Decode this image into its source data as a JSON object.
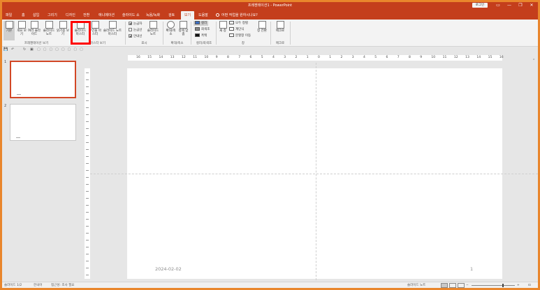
{
  "titlebar": {
    "title": "프레젠테이션1 - PowerPoint",
    "signin": "로그인",
    "minimize": "—",
    "restore": "❐",
    "close": "✕"
  },
  "tabs": [
    {
      "label": "파일"
    },
    {
      "label": "홈"
    },
    {
      "label": "삽입"
    },
    {
      "label": "그리기"
    },
    {
      "label": "디자인"
    },
    {
      "label": "전환"
    },
    {
      "label": "애니메이션"
    },
    {
      "label": "슬라이드 쇼"
    },
    {
      "label": "녹음/녹화"
    },
    {
      "label": "검토"
    },
    {
      "label": "보기"
    },
    {
      "label": "도움말"
    }
  ],
  "active_tab": "보기",
  "tellme": "어떤 작업을 원하시나요?",
  "ribbon": {
    "views": {
      "normal": "기본",
      "outline": "개요 보기",
      "sorter": "여러 슬라이드",
      "notes": "슬라이드 노트",
      "reading": "읽기용 보기",
      "group_label": "프레젠테이션 보기"
    },
    "master": {
      "slide_master": "슬라이드 마스터",
      "handout_master": "유인물 마스터",
      "notes_master": "슬라이드 노트 마스터",
      "group_label": "마스터 보기"
    },
    "show": {
      "ruler": "눈금자",
      "gridlines": "눈금선",
      "guides": "안내선",
      "notes": "슬라이드 노트",
      "group_label": "표시"
    },
    "zoom": {
      "zoom": "확대/축소",
      "fit": "창에 맞춤",
      "group_label": "확대/축소"
    },
    "color": {
      "color": "컬러",
      "grayscale": "회색조",
      "bw": "흑백",
      "group_label": "컬러/회색조"
    },
    "window": {
      "new_window": "새 창",
      "arrange_all": "모두 정렬",
      "cascade": "계단식",
      "move_split": "분할창 이동",
      "switch": "창 전환",
      "group_label": "창"
    },
    "macro": {
      "macro": "매크로",
      "group_label": "매크로"
    }
  },
  "checkboxes": {
    "ruler": true,
    "gridlines": false,
    "guides": true
  },
  "qat": {
    "save": "💾",
    "undo": "↶",
    "redo": "↻",
    "start": "▣"
  },
  "thumbnails": [
    {
      "number": "1",
      "selected": true
    },
    {
      "number": "2",
      "selected": false
    }
  ],
  "hruler_labels": [
    "16",
    "15",
    "14",
    "13",
    "12",
    "11",
    "10",
    "9",
    "8",
    "7",
    "6",
    "5",
    "4",
    "3",
    "2",
    "1",
    "0",
    "1",
    "2",
    "3",
    "4",
    "5",
    "6",
    "7",
    "8",
    "9",
    "10",
    "11",
    "12",
    "13",
    "14",
    "15",
    "16"
  ],
  "slide": {
    "date": "2024-02-02",
    "page_number": "1"
  },
  "statusbar": {
    "slide_info": "슬라이드 1/2",
    "language": "한국어",
    "accessibility": "접근성: 조사 필요",
    "notes": "슬라이드 노트"
  },
  "colors": {
    "accent": "#c43e1c",
    "frame": "#e9862c",
    "highlight": "#ff0000",
    "selected_thumb": "#d24726"
  }
}
